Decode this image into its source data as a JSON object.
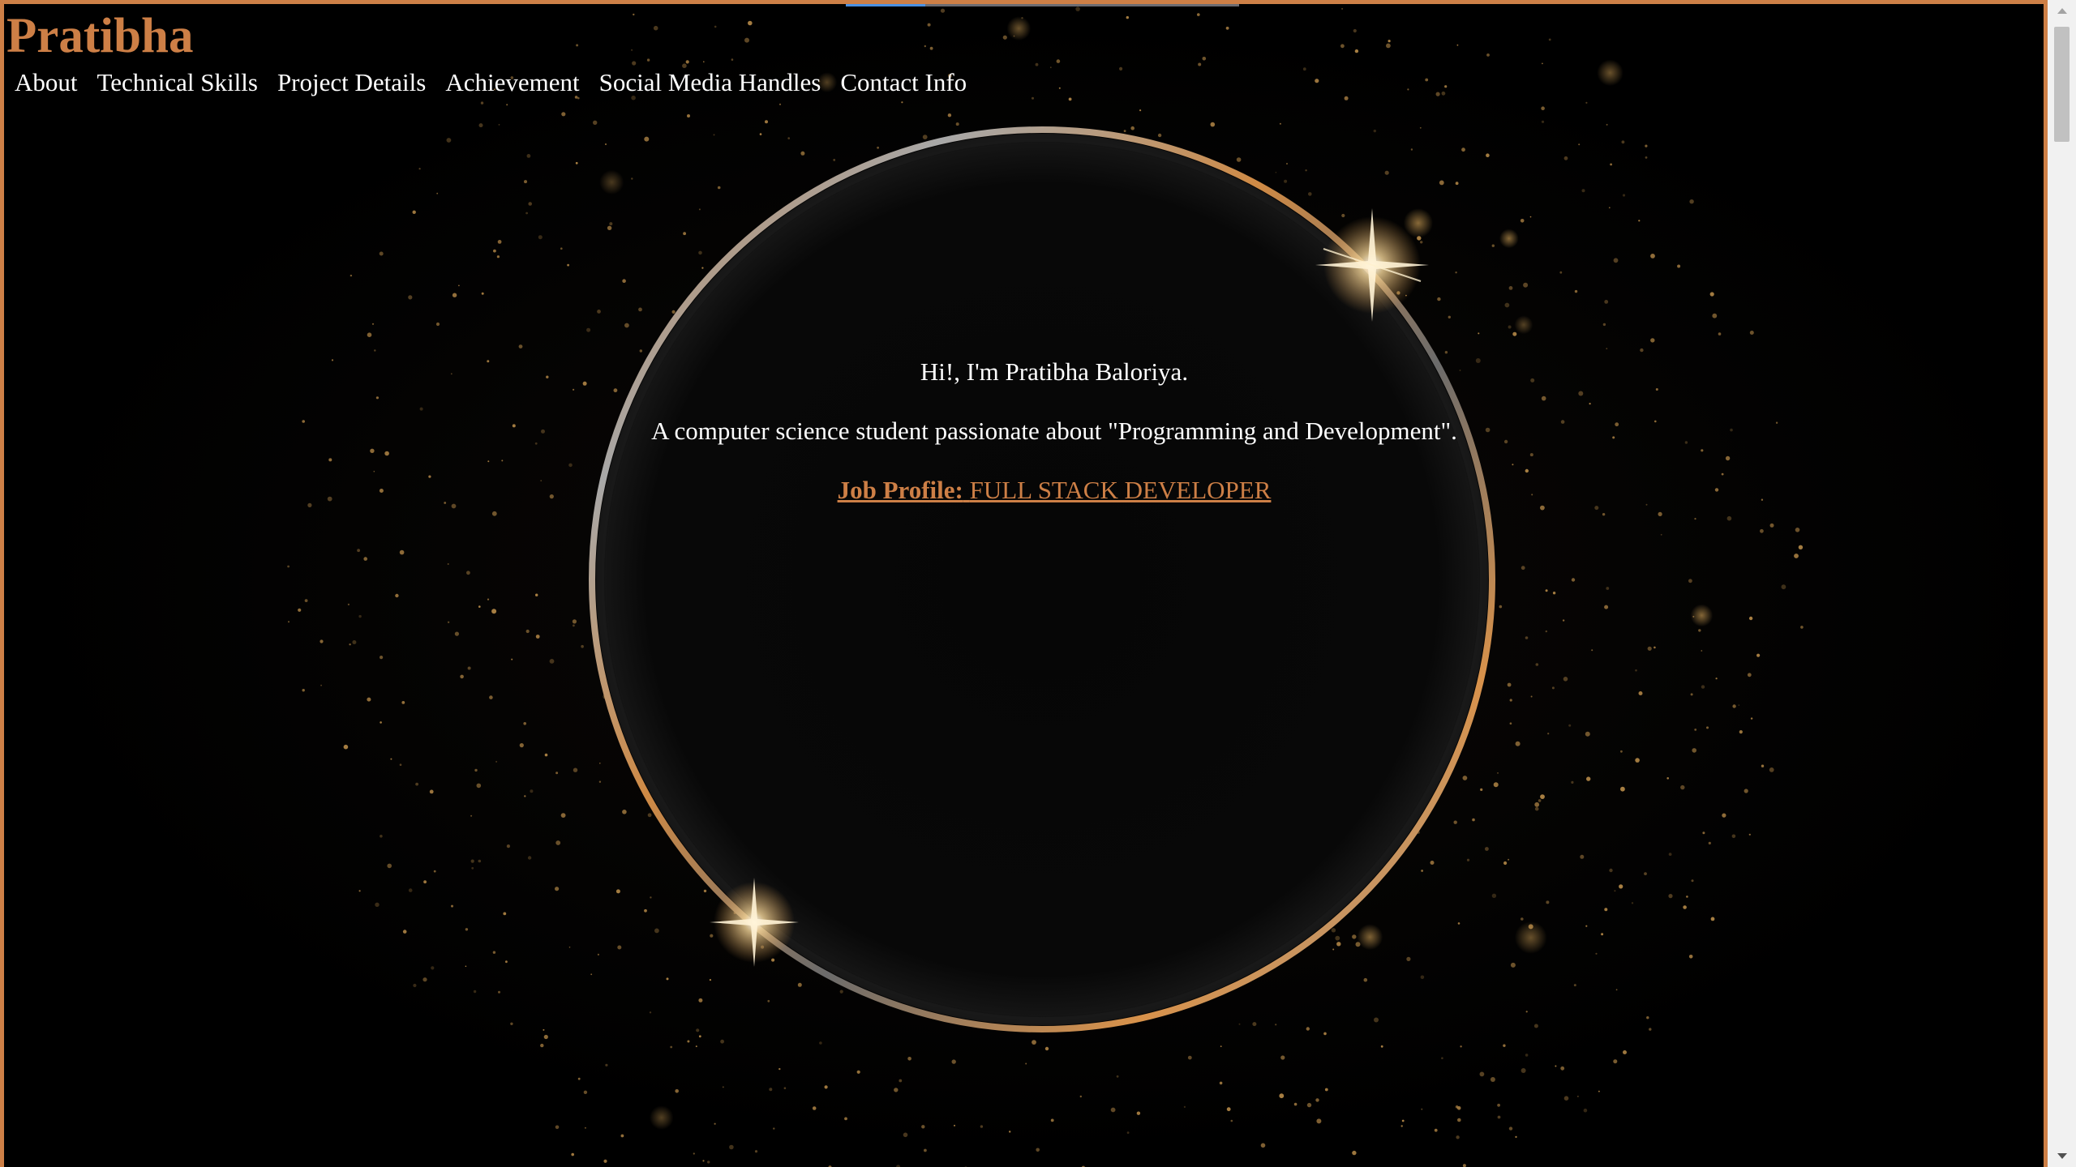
{
  "site": {
    "brand": "Pratibha"
  },
  "nav": {
    "items": [
      {
        "label": "About"
      },
      {
        "label": "Technical Skills"
      },
      {
        "label": "Project Details"
      },
      {
        "label": "Achievement"
      },
      {
        "label": "Social Media Handles"
      },
      {
        "label": "Contact Info"
      }
    ]
  },
  "hero": {
    "greeting": "Hi!, I'm Pratibha Baloriya.",
    "tagline": "A computer science student passionate about \"Programming and Development\".",
    "job_label": "Job Profile:",
    "job_title": "FULL STACK DEVELOPER"
  },
  "colors": {
    "accent": "#cd7f46",
    "text": "#ffffff",
    "background": "#000000"
  },
  "icons": {
    "scroll_up": "chevron-up-icon",
    "scroll_down": "chevron-down-icon"
  }
}
